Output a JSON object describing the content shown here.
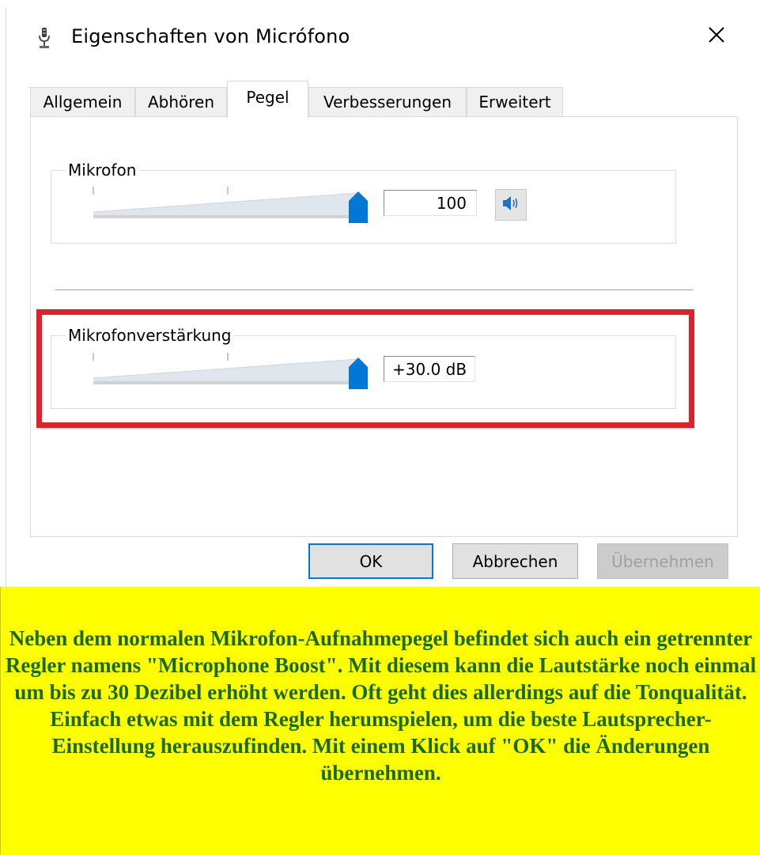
{
  "dialog": {
    "title": "Eigenschaften von Micrófono",
    "title_icon": "microphone-icon",
    "close_icon": "close-icon"
  },
  "tabs": [
    {
      "label": "Allgemein",
      "active": false
    },
    {
      "label": "Abhören",
      "active": false
    },
    {
      "label": "Pegel",
      "active": true
    },
    {
      "label": "Verbesserungen",
      "active": false
    },
    {
      "label": "Erweitert",
      "active": false
    }
  ],
  "mikrofon": {
    "label": "Mikrofon",
    "value": "100",
    "level": 1.0,
    "speaker_icon": "speaker-icon"
  },
  "boost": {
    "label": "Mikrofonverstärkung",
    "value": "+30.0 dB",
    "level": 1.0
  },
  "buttons": {
    "ok": "OK",
    "cancel": "Abbrechen",
    "apply": "Übernehmen"
  },
  "note": {
    "text": "Neben dem normalen Mikrofon-Aufnahmepegel befindet sich auch ein getrennter Regler namens \"Microphone Boost\". Mit diesem kann die Lautstärke noch einmal um bis zu 30 Dezibel erhöht werden. Oft geht dies allerdings auf die Tonqualität. Einfach etwas mit dem Regler herumspielen, um die beste Lautsprecher-Einstellung herauszufinden. Mit einem Klick auf \"OK\" die Änderungen übernehmen."
  },
  "colors": {
    "accent": "#0078d7",
    "highlight": "#e0202a",
    "note_background": "#ffff00",
    "note_text": "#1a6a14"
  }
}
